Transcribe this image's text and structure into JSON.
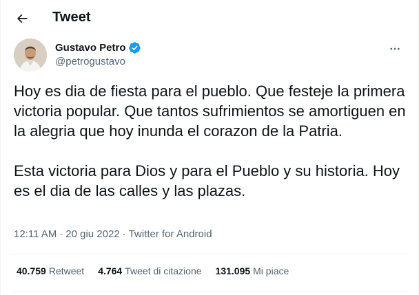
{
  "header": {
    "title": "Tweet",
    "back_icon": "arrow-left-icon"
  },
  "author": {
    "name": "Gustavo Petro",
    "handle": "@petrogustavo",
    "verified_icon": "verified-badge-icon",
    "more_icon": "more-horizontal-icon"
  },
  "tweet": {
    "paragraphs": [
      "Hoy es dia de fiesta para el pueblo. Que festeje la primera victoria popular. Que tantos sufrimientos se amortiguen en la alegria que hoy inunda el corazon de la Patria.",
      "Esta victoria para Dios y para el Pueblo y su historia. Hoy es el dia de las calles y las plazas."
    ],
    "time": "12:11 AM",
    "date": "20 giu 2022",
    "separator": "·",
    "source": "Twitter for Android"
  },
  "stats": {
    "retweets": {
      "count": "40.759",
      "label": "Retweet"
    },
    "quotes": {
      "count": "4.764",
      "label": "Tweet di citazione"
    },
    "likes": {
      "count": "131.095",
      "label": "Mi piace"
    }
  },
  "colors": {
    "text": "#0f1419",
    "secondary": "#536471",
    "verified": "#1d9bf0",
    "border": "#eff3f4"
  }
}
